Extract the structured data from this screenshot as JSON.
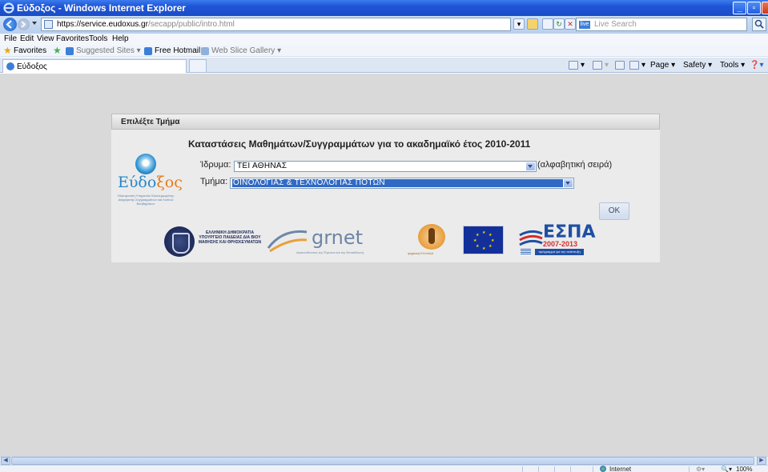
{
  "window": {
    "title": "Εύδοξος - Windows Internet Explorer"
  },
  "address_bar": {
    "url_host": "https://service.eudoxus.gr",
    "url_path": "/secapp/public/intro.html",
    "search_placeholder": "Live Search"
  },
  "menu": [
    "File",
    "Edit",
    "View",
    "Favorites",
    "Tools",
    "Help"
  ],
  "favorites_bar": {
    "label": "Favorites",
    "items": [
      "Suggested Sites ▾",
      "Free Hotmail",
      "Web Slice Gallery ▾"
    ]
  },
  "tabs": [
    {
      "label": "Εύδοξος"
    }
  ],
  "command_bar": {
    "page": "Page ▾",
    "safety": "Safety ▾",
    "tools": "Tools ▾"
  },
  "panel": {
    "header": "Επιλέξτε Τμήμα",
    "heading": "Καταστάσεις Μαθημάτων/Συγγραμμάτων για το ακαδημαϊκό έτος 2010-2011",
    "institution_label": "Ίδρυμα:",
    "institution_value": "ΤΕΙ ΑΘΗΝΑΣ",
    "institution_hint": "(αλφαβητική σειρά)",
    "department_label": "Τμήμα:",
    "department_value": "ΟΙΝΟΛΟΓΙΑΣ & ΤΕΧΝΟΛΟΓΙΑΣ ΠΟΤΩΝ",
    "ok_label": "OK"
  },
  "logo": {
    "word_start": "Εύδο",
    "word_end": "ξος",
    "tagline": "Ηλεκτρονική Υπηρεσία Ολοκληρωμένης Διαχείρισης Συγγραμμάτων και Λοιπών Βοηθημάτων"
  },
  "sponsors": {
    "ministry": "ΕΛΛΗΝΙΚΗ ΔΗΜΟΚΡΑΤΙΑ ΥΠΟΥΡΓΕΙΟ ΠΑΙΔΕΙΑΣ ΔΙΑ ΒΙΟΥ ΜΑΘΗΣΗΣ ΚΑΙ ΘΡΗΣΚΕΥΜΑΤΩΝ",
    "grnet": "grnet",
    "grnet_tag": "Διασυνδέοντας την Έρευνα και την Εκπαίδευση",
    "pgo_tag": "ψηφιακή ΕΛΛΑΔΑ",
    "espa": "ΕΣΠΑ",
    "espa_years": "2007-2013",
    "espa_bar": "πρόγραμμα για την ανάπτυξη"
  },
  "status_bar": {
    "zone": "Internet",
    "zoom": "100%"
  },
  "colors": {
    "title_bar": "#1f55d6",
    "selection": "#316ac5",
    "content_bg": "#d9d9d9",
    "panel_bg": "#ebebeb",
    "logo_blue": "#2587cc",
    "logo_orange": "#e97a17"
  }
}
